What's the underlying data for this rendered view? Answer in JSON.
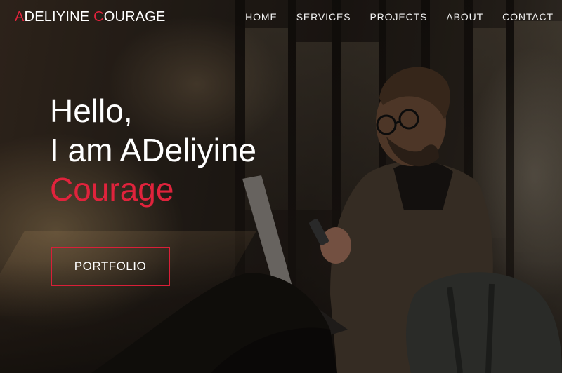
{
  "brand": {
    "first_letter": "A",
    "first_rest": "DELIYINE",
    "second_letter": "C",
    "second_rest": "OURAGE",
    "accent_color": "#e0233c"
  },
  "nav": {
    "items": [
      {
        "label": "HOME"
      },
      {
        "label": "SERVICES"
      },
      {
        "label": "PROJECTS"
      },
      {
        "label": "ABOUT"
      },
      {
        "label": "CONTACT"
      }
    ]
  },
  "hero": {
    "line1": "Hello,",
    "line2": "I am ADeliyine",
    "line3": "Courage",
    "button_label": "PORTFOLIO",
    "background_image": "photo of a man with glasses sitting by a window, holding a phone with a laptop on his lap"
  }
}
